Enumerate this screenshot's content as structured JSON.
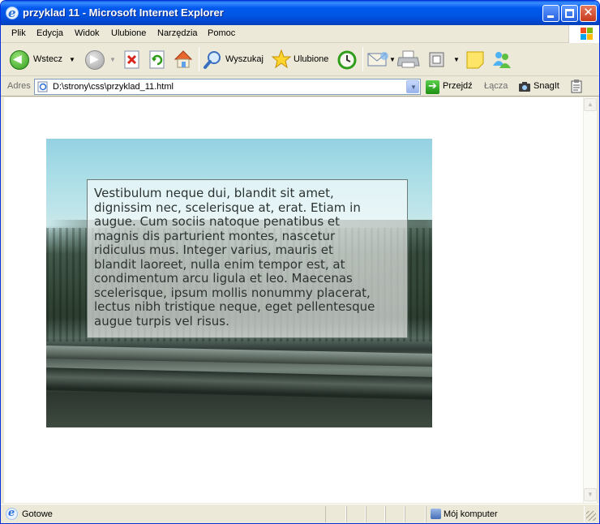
{
  "window": {
    "title": "przyklad 11 - Microsoft Internet Explorer"
  },
  "menu": {
    "items": [
      "Plik",
      "Edycja",
      "Widok",
      "Ulubione",
      "Narzędzia",
      "Pomoc"
    ]
  },
  "toolbar": {
    "back_label": "Wstecz",
    "search_label": "Wyszukaj",
    "favorites_label": "Ulubione"
  },
  "address": {
    "label": "Adres",
    "value": "D:\\strony\\css\\przyklad_11.html",
    "go_label": "Przejdź",
    "links_label": "Łącza",
    "snagit_label": "SnagIt"
  },
  "page": {
    "paragraph_lines": [
      "Vestibulum neque dui, blandit sit amet,",
      "dignissim nec, scelerisque at, erat. Etiam in",
      "augue. Cum sociis natoque penatibus et",
      "magnis dis parturient montes, nascetur",
      "ridiculus mus. Integer varius, mauris et",
      "blandit laoreet, nulla enim tempor est, at",
      "condimentum arcu ligula et leo. Maecenas",
      "scelerisque, ipsum mollis nonummy placerat,",
      "lectus nibh tristique neque, eget pellentesque",
      "augue turpis vel risus."
    ]
  },
  "status": {
    "text": "Gotowe",
    "zone": "Mój komputer"
  }
}
